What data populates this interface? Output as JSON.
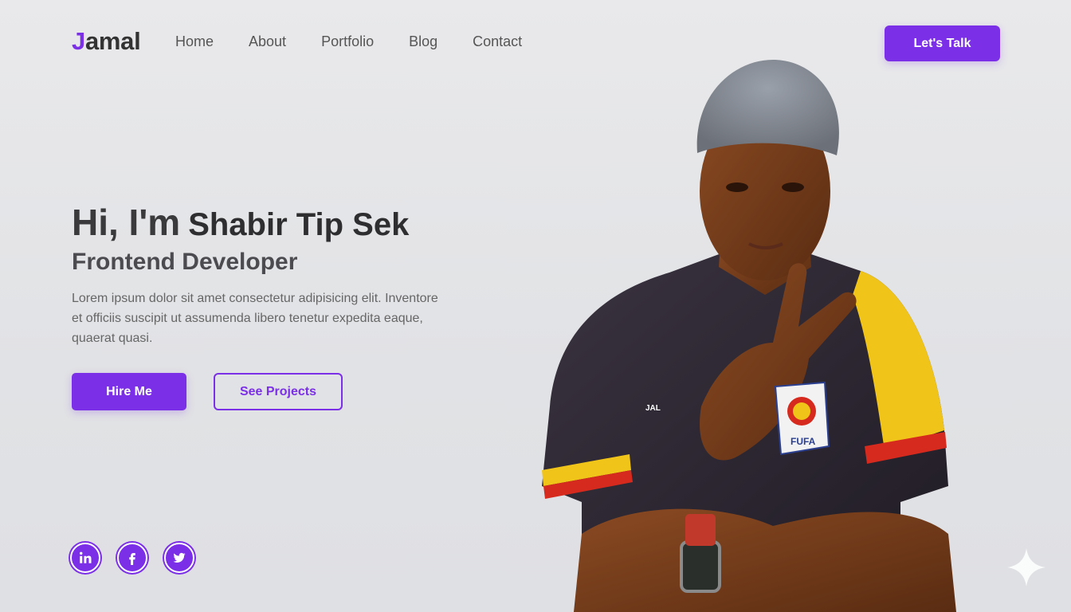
{
  "nav": {
    "logo_initial": "J",
    "logo_rest": "amal",
    "items": [
      {
        "label": "Home"
      },
      {
        "label": "About"
      },
      {
        "label": "Portfolio"
      },
      {
        "label": "Blog"
      },
      {
        "label": "Contact"
      }
    ],
    "cta_label": "Let's Talk"
  },
  "hero": {
    "greeting": "Hi, I'm",
    "name": "Shabir Tip Sek",
    "role": "Frontend Developer",
    "description": "Lorem ipsum dolor sit amet consectetur adipisicing elit. Inventore et officiis suscipit ut assumenda libero tenetur expedita eaque, quaerat quasi.",
    "primary_button": "Hire Me",
    "secondary_button": "See Projects"
  },
  "socials": [
    {
      "icon": "linkedin-icon"
    },
    {
      "icon": "facebook-icon"
    },
    {
      "icon": "twitter-icon"
    }
  ],
  "photo": {
    "jersey_badge": "FUFA",
    "jersey_name": "JAL"
  },
  "colors": {
    "accent": "#7b2fe6",
    "background": "#e6e6e8",
    "text": "#3b3b3f"
  }
}
